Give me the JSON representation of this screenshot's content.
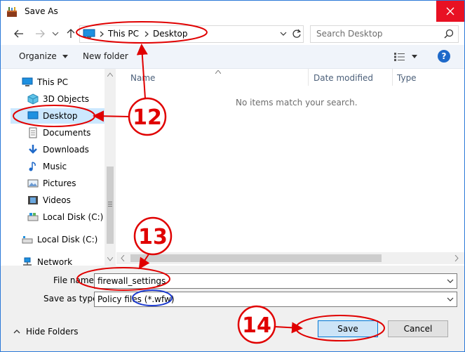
{
  "window": {
    "title": "Save As"
  },
  "address_bar": {
    "crumbs": [
      "This PC",
      "Desktop"
    ]
  },
  "search": {
    "placeholder": "Search Desktop"
  },
  "toolbar": {
    "organize": "Organize",
    "new_folder": "New folder",
    "help": "?"
  },
  "nav_pane": {
    "items": [
      {
        "label": "This PC",
        "icon": "pc-icon"
      },
      {
        "label": "3D Objects",
        "icon": "cube-icon"
      },
      {
        "label": "Desktop",
        "icon": "desktop-icon",
        "selected": true
      },
      {
        "label": "Documents",
        "icon": "document-icon"
      },
      {
        "label": "Downloads",
        "icon": "download-icon"
      },
      {
        "label": "Music",
        "icon": "music-icon"
      },
      {
        "label": "Pictures",
        "icon": "picture-icon"
      },
      {
        "label": "Videos",
        "icon": "video-icon"
      },
      {
        "label": "Local Disk (C:)",
        "icon": "disk-icon"
      },
      {
        "label": "Local Disk (C:)",
        "icon": "drive-icon"
      },
      {
        "label": "Network",
        "icon": "network-icon"
      }
    ]
  },
  "columns": {
    "name": "Name",
    "date_modified": "Date modified",
    "type": "Type"
  },
  "content": {
    "empty_message": "No items match your search."
  },
  "form": {
    "file_name_label": "File name:",
    "file_name_value": "firewall_settings",
    "save_as_type_label": "Save as type:",
    "save_as_type_value_prefix": "Policy files ",
    "save_as_type_value_ext": "(*.wfw)"
  },
  "footer": {
    "hide_folders": "Hide Folders",
    "save": "Save",
    "cancel": "Cancel"
  },
  "annotations": {
    "step_12": "12",
    "step_13": "13",
    "step_14": "14"
  },
  "colors": {
    "accent": "#0078d7",
    "selected": "#cce8ff",
    "annotation": "#e00000",
    "close": "#e81123"
  }
}
